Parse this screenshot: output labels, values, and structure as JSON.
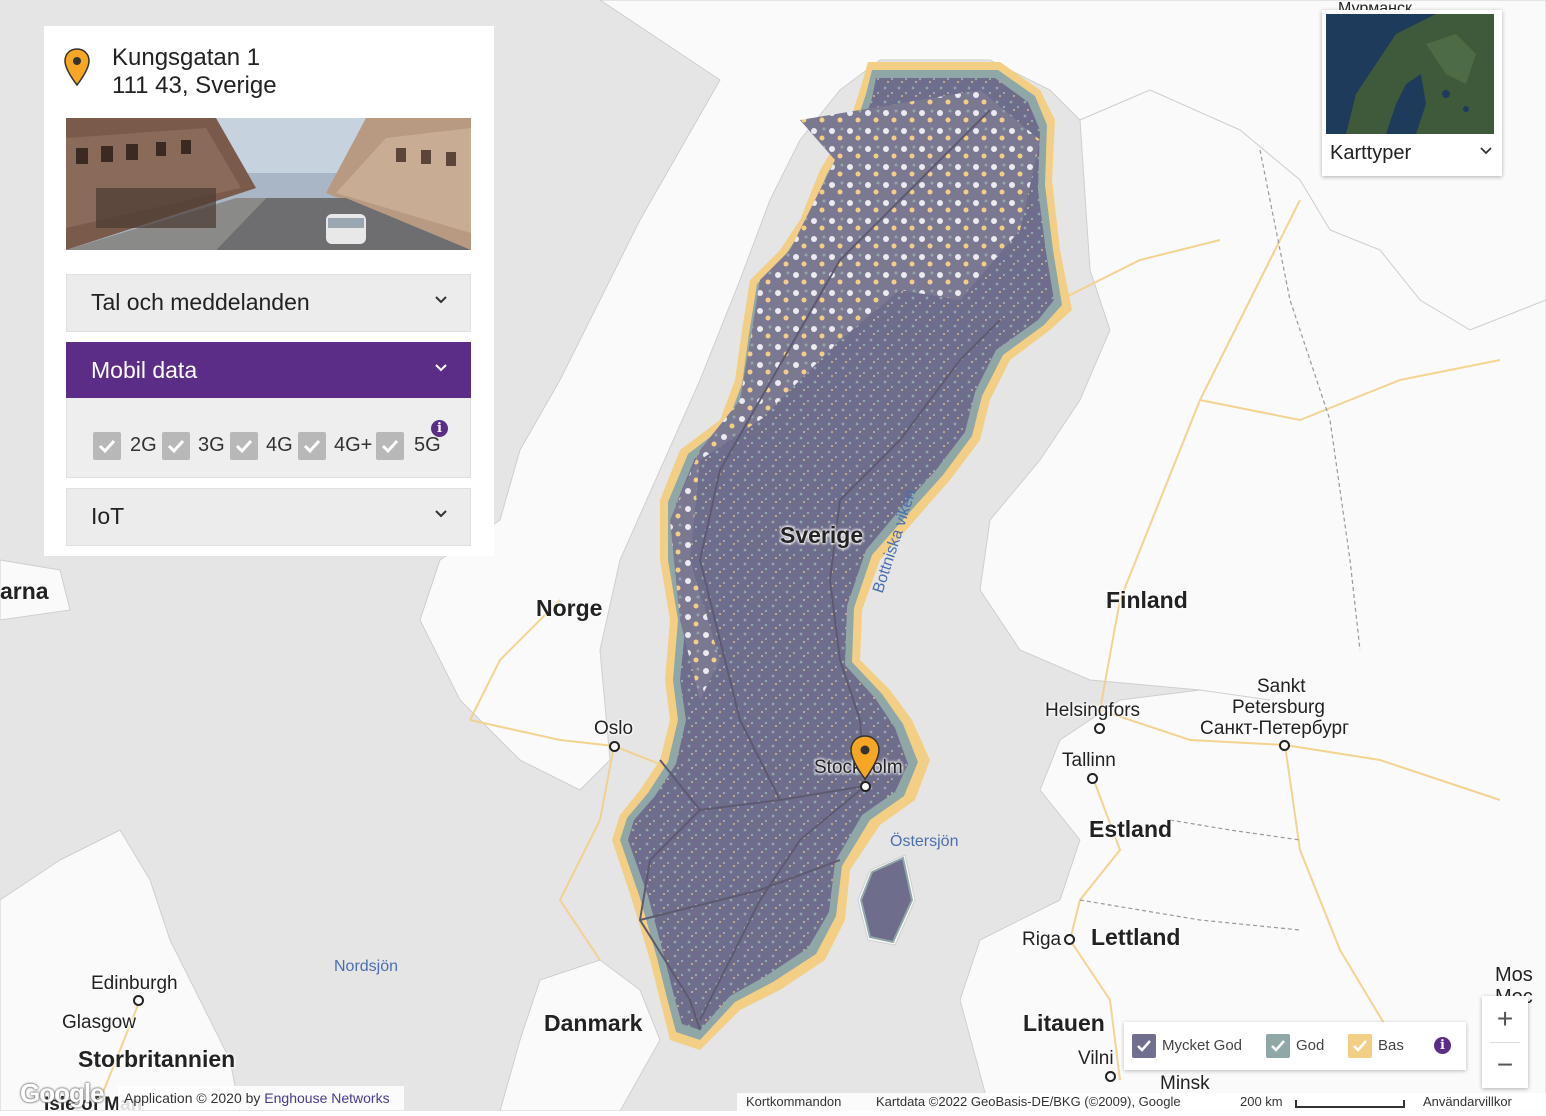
{
  "panel": {
    "address_line1": "Kungsgatan 1",
    "address_line2": "111 43, Sverige",
    "accordions": [
      {
        "label": "Tal och meddelanden",
        "expanded": false
      },
      {
        "label": "Mobil data",
        "expanded": true
      },
      {
        "label": "IoT",
        "expanded": false
      }
    ],
    "mobile_data_options": [
      {
        "label": "2G",
        "checked": true
      },
      {
        "label": "3G",
        "checked": true
      },
      {
        "label": "4G",
        "checked": true
      },
      {
        "label": "4G+",
        "checked": true
      },
      {
        "label": "5G",
        "checked": true
      }
    ],
    "info_icon": "i"
  },
  "map_type": {
    "label": "Karttyper"
  },
  "map_labels": {
    "countries": {
      "sverige": "Sverige",
      "norge": "Norge",
      "finland": "Finland",
      "estland": "Estland",
      "lettland": "Lettland",
      "litauen": "Litauen",
      "danmark": "Danmark",
      "storbritannien": "Storbritannien",
      "faroes_partial": "arna",
      "moscow_partial_1": "Mos",
      "moscow_partial_2": "Moc"
    },
    "cities": {
      "stockholm": "Stockholm",
      "oslo": "Oslo",
      "helsingfors": "Helsingfors",
      "tallinn": "Tallinn",
      "riga": "Riga",
      "vilnius_partial": "Vilni",
      "minsk": "Minsk",
      "edinburgh": "Edinburgh",
      "glasgow": "Glasgow",
      "isle_of_man": "Isle of Man",
      "murmansk_partial": "Мурманск",
      "sankt_1": "Sankt",
      "sankt_2": "Petersburg",
      "sankt_3": "Санкт-Петербург"
    },
    "waters": {
      "bottniska": "Bottniska viken",
      "ostersjon": "Östersjön",
      "nordsjon": "Nordsjön"
    }
  },
  "legend": {
    "items": [
      {
        "label": "Mycket God",
        "color": "#706e8e"
      },
      {
        "label": "God",
        "color": "#8fa7a7"
      },
      {
        "label": "Bas",
        "color": "#f3cf86"
      }
    ],
    "info_icon": "i"
  },
  "zoom": {
    "in": "+",
    "out": "−"
  },
  "attribution": {
    "google": "Google",
    "app_prefix": "Application © 2020 by ",
    "app_link": "Enghouse Networks",
    "shortcuts": "Kortkommandon",
    "map_data": "Kartdata ©2022 GeoBasis-DE/BKG (©2009), Google",
    "scale": "200 km",
    "terms": "Användarvillkor"
  },
  "colors": {
    "accent_purple": "#5b2d86",
    "coverage_very_good": "#706e8e",
    "coverage_good": "#8fa7a7",
    "coverage_basic": "#f3cf86",
    "marker": "#f5a623"
  }
}
